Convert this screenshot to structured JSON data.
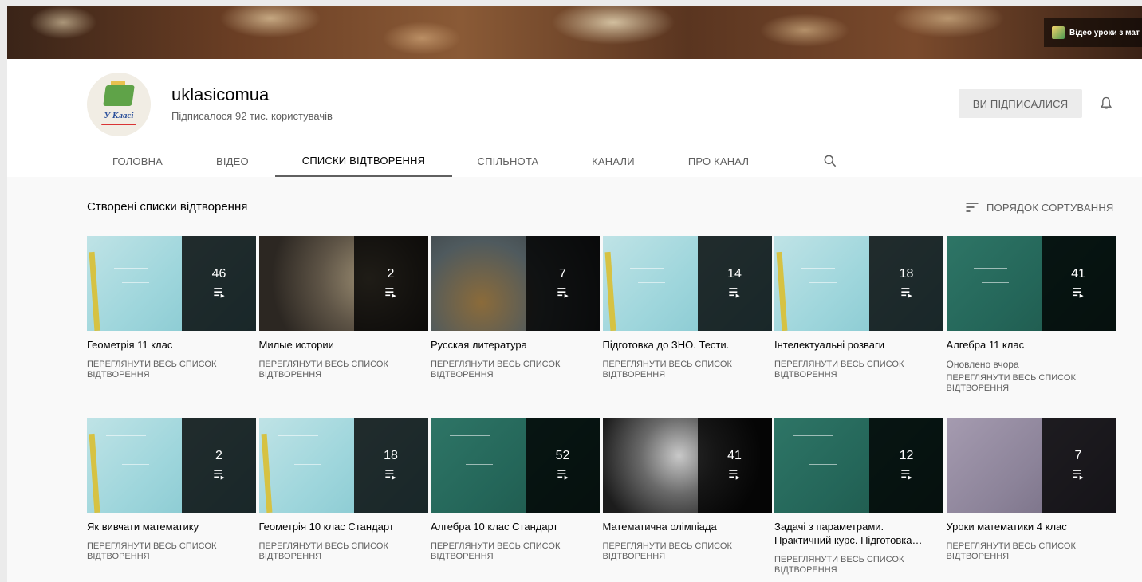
{
  "banner": {
    "link_text": "Відео уроки з мат"
  },
  "channel": {
    "name": "uklasicomua",
    "subscribers": "Підписалося 92 тис. користувачів",
    "avatar_text": "У Класі",
    "subscribed_label": "ВИ ПІДПИСАЛИСЯ"
  },
  "tabs": [
    {
      "label": "ГОЛОВНА"
    },
    {
      "label": "ВІДЕО"
    },
    {
      "label": "СПИСКИ ВІДТВОРЕННЯ",
      "active": true
    },
    {
      "label": "СПІЛЬНОТА"
    },
    {
      "label": "КАНАЛИ"
    },
    {
      "label": "ПРО КАНАЛ"
    }
  ],
  "section": {
    "title": "Створені списки відтворення",
    "sort_label": "ПОРЯДОК СОРТУВАННЯ"
  },
  "playlists": [
    {
      "title": "Геометрія 11 клас",
      "count": "46",
      "meta": "",
      "link": "ПЕРЕГЛЯНУТИ ВЕСЬ СПИСОК ВІДТВОРЕННЯ",
      "thumb": "board"
    },
    {
      "title": "Милые истории",
      "count": "2",
      "meta": "",
      "link": "ПЕРЕГЛЯНУТИ ВЕСЬ СПИСОК ВІДТВОРЕННЯ",
      "thumb": "cat"
    },
    {
      "title": "Русская литература",
      "count": "7",
      "meta": "",
      "link": "ПЕРЕГЛЯНУТИ ВЕСЬ СПИСОК ВІДТВОРЕННЯ",
      "thumb": "paint"
    },
    {
      "title": "Підготовка до ЗНО. Тести.",
      "count": "14",
      "meta": "",
      "link": "ПЕРЕГЛЯНУТИ ВЕСЬ СПИСОК ВІДТВОРЕННЯ",
      "thumb": "board"
    },
    {
      "title": "Інтелектуальні розваги",
      "count": "18",
      "meta": "",
      "link": "ПЕРЕГЛЯНУТИ ВЕСЬ СПИСОК ВІДТВОРЕННЯ",
      "thumb": "board"
    },
    {
      "title": "Алгебра 11 клас",
      "count": "41",
      "meta": "Оновлено вчора",
      "link": "ПЕРЕГЛЯНУТИ ВЕСЬ СПИСОК ВІДТВОРЕННЯ",
      "thumb": "green"
    },
    {
      "title": "Як вивчати математику",
      "count": "2",
      "meta": "",
      "link": "ПЕРЕГЛЯНУТИ ВЕСЬ СПИСОК ВІДТВОРЕННЯ",
      "thumb": "board"
    },
    {
      "title": "Геометрія 10 клас Стандарт",
      "count": "18",
      "meta": "",
      "link": "ПЕРЕГЛЯНУТИ ВЕСЬ СПИСОК ВІДТВОРЕННЯ",
      "thumb": "board"
    },
    {
      "title": "Алгебра 10 клас Стандарт",
      "count": "52",
      "meta": "",
      "link": "ПЕРЕГЛЯНУТИ ВЕСЬ СПИСОК ВІДТВОРЕННЯ",
      "thumb": "green"
    },
    {
      "title": "Математична олімпіада",
      "count": "41",
      "meta": "",
      "link": "ПЕРЕГЛЯНУТИ ВЕСЬ СПИСОК ВІДТВОРЕННЯ",
      "thumb": "dark"
    },
    {
      "title": "Задачі з параметрами. Практичний курс. Підготовка…",
      "count": "12",
      "meta": "",
      "link": "ПЕРЕГЛЯНУТИ ВЕСЬ СПИСОК ВІДТВОРЕННЯ",
      "thumb": "green"
    },
    {
      "title": "Уроки математики 4 клас",
      "count": "7",
      "meta": "",
      "link": "ПЕРЕГЛЯНУТИ ВЕСЬ СПИСОК ВІДТВОРЕННЯ",
      "thumb": "purple"
    }
  ],
  "icons": {
    "search": "search-icon",
    "bell": "bell-icon",
    "sort": "sort-icon",
    "playlist": "playlist-icon"
  }
}
